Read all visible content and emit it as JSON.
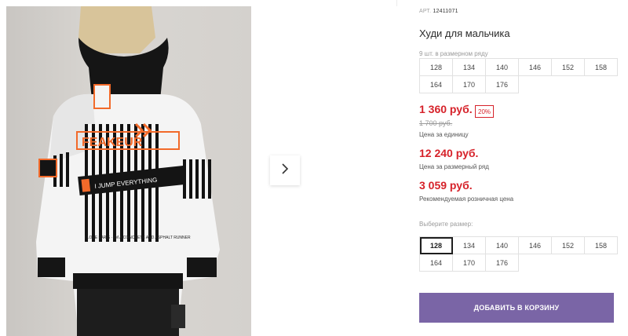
{
  "gallery": {
    "next_icon": "chevron-right-icon",
    "print_text_top": "FEAKEUR",
    "print_text_middle": "I JUMP EVERYTHING",
    "print_text_bottom": "I LOVE PARIS · I'M A CONCRETE AND ASPHALT RUNNER"
  },
  "product": {
    "article_label": "АРТ.",
    "article_number": "12411071",
    "title": "Худи для мальчика",
    "sizes_in_set": "9 шт. в размерном ряду",
    "set_sizes": [
      "128",
      "134",
      "140",
      "146",
      "152",
      "158",
      "164",
      "170",
      "176"
    ],
    "price": "1 360 руб.",
    "discount": "20%",
    "old_price": "1 700 руб.",
    "price_unit_note": "Цена за единицу",
    "set_price": "12 240 руб.",
    "set_price_note": "Цена за размерный ряд",
    "rrp_price": "3 059 руб.",
    "rrp_note": "Рекомендуемая розничная цена",
    "choose_size_label": "Выберите размер:",
    "selectable_sizes": [
      "128",
      "134",
      "140",
      "146",
      "152",
      "158",
      "164",
      "170",
      "176"
    ],
    "selected_size": "128",
    "add_to_cart": "ДОБАВИТЬ В КОРЗИНУ"
  },
  "colors": {
    "accent_price": "#d6222a",
    "button": "#7a65a6"
  }
}
